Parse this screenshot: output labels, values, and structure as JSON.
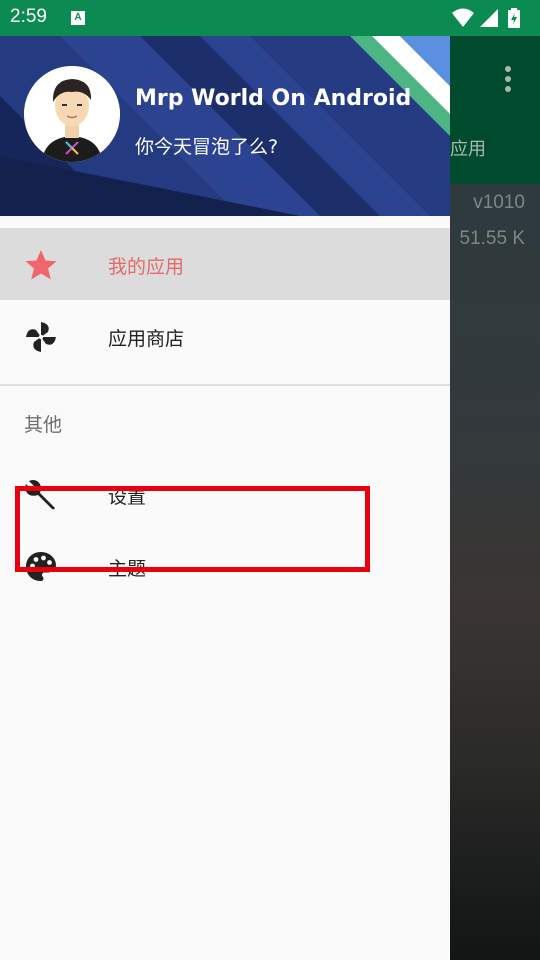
{
  "status_bar": {
    "time": "2:59",
    "app_icon_letter": "A",
    "icons": [
      "wifi-icon",
      "signal-icon",
      "battery-icon"
    ]
  },
  "background_app": {
    "tab_label": "应用",
    "version": "v1010",
    "size": "51.55 K"
  },
  "drawer": {
    "header": {
      "title": "Mrp World On Android",
      "subtitle": "你今天冒泡了么?"
    },
    "items": [
      {
        "label": "我的应用",
        "icon": "star-icon",
        "selected": true
      },
      {
        "label": "应用商店",
        "icon": "pinwheel-icon",
        "selected": false
      }
    ],
    "section_title": "其他",
    "other_items": [
      {
        "label": "设置",
        "icon": "wrench-icon"
      },
      {
        "label": "主题",
        "icon": "palette-icon"
      }
    ]
  },
  "colors": {
    "status_bar": "#0b8a52",
    "selected_text": "#e56a6a",
    "highlight_box": "#e8000e"
  }
}
